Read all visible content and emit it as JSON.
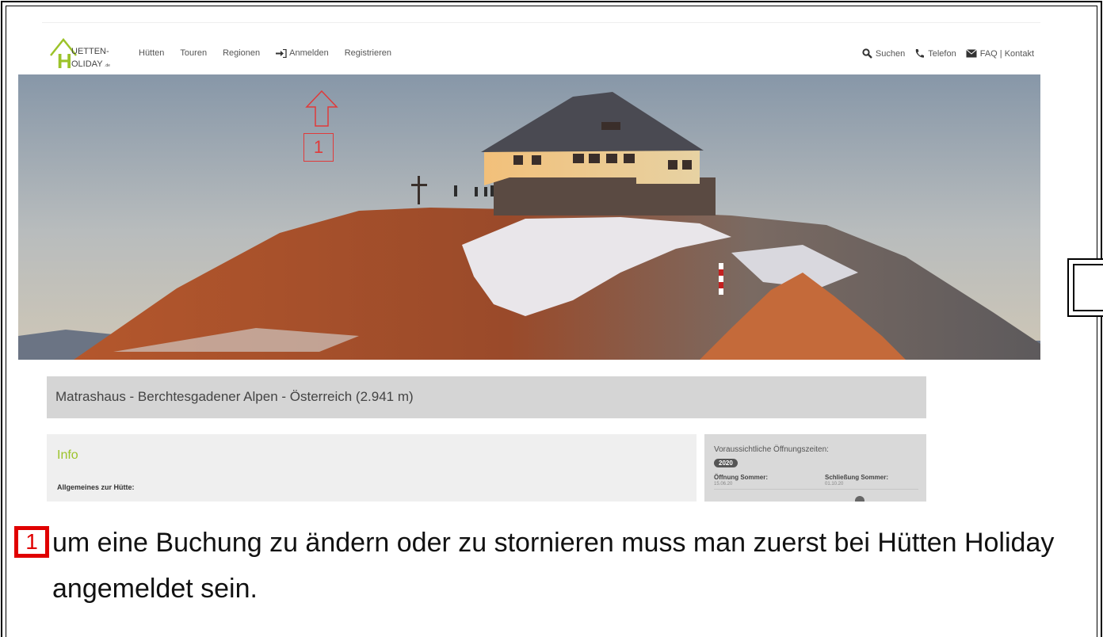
{
  "site": {
    "logo": {
      "line1": "UETTEN-",
      "line2": "OLIDAY",
      "suffix": ".de",
      "letter": "H"
    },
    "nav_left": [
      {
        "label": "Hütten"
      },
      {
        "label": "Touren"
      },
      {
        "label": "Regionen"
      },
      {
        "label": "Anmelden"
      },
      {
        "label": "Registrieren"
      }
    ],
    "nav_right": [
      {
        "label": "Suchen"
      },
      {
        "label": "Telefon"
      },
      {
        "label": "FAQ | Kontakt"
      }
    ],
    "page_title": "Matrashaus - Berchtesgadener Alpen - Österreich (2.941 m)",
    "info": {
      "title": "Info",
      "subtitle": "Allgemeines zur Hütte:"
    },
    "opening": {
      "title": "Voraussichtliche Öffnungszeiten:",
      "year": "2020",
      "open_label": "Öffnung Sommer:",
      "close_label": "Schließung Sommer:",
      "open_value": "15.06.20",
      "close_value": "01.10.20"
    }
  },
  "annotation": {
    "marker": "1",
    "text": "um eine Buchung zu ändern oder zu stornieren muss man zuerst bei Hütten Holiday angemeldet sein.",
    "color": "#e00000"
  },
  "colors": {
    "accent_green": "#9cc32a",
    "title_bar": "#d5d5d5"
  }
}
